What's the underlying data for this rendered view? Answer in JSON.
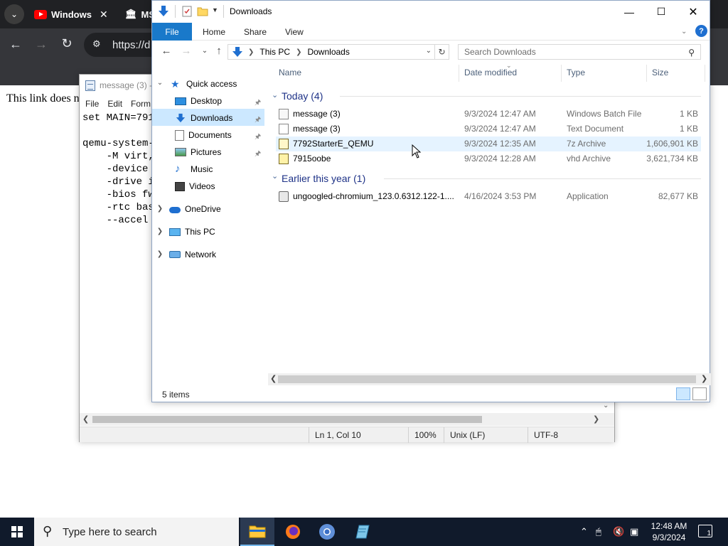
{
  "browser": {
    "tab1_title": "Windows",
    "tab2_title": "MS",
    "address_text": "https://d",
    "page_text": "This link does n"
  },
  "notepad": {
    "title": "message (3) -",
    "menu": [
      "File",
      "Edit",
      "Form"
    ],
    "lines": [
      "set MAIN=791",
      "",
      "qemu-system-",
      "    -M virt,",
      "    -device ",
      "    -drive i",
      "    -bios fw",
      "    -rtc bas",
      "    --accel "
    ],
    "status": {
      "position": "Ln 1, Col 10",
      "zoom": "100%",
      "line_ending": "Unix (LF)",
      "encoding": "UTF-8"
    }
  },
  "explorer": {
    "title": "Downloads",
    "ribbon_tabs": {
      "file": "File",
      "home": "Home",
      "share": "Share",
      "view": "View"
    },
    "help": "?",
    "breadcrumb": [
      "This PC",
      "Downloads"
    ],
    "search_placeholder": "Search Downloads",
    "nav": {
      "quick_access": "Quick access",
      "desktop": "Desktop",
      "downloads": "Downloads",
      "documents": "Documents",
      "pictures": "Pictures",
      "music": "Music",
      "videos": "Videos",
      "onedrive": "OneDrive",
      "this_pc": "This PC",
      "network": "Network"
    },
    "columns": {
      "name": "Name",
      "date": "Date modified",
      "type": "Type",
      "size": "Size"
    },
    "groups": {
      "today": "Today (4)",
      "earlier": "Earlier this year (1)"
    },
    "files": [
      {
        "name": "message (3)",
        "date": "9/3/2024 12:47 AM",
        "type": "Windows Batch File",
        "size": "1 KB"
      },
      {
        "name": "message (3)",
        "date": "9/3/2024 12:47 AM",
        "type": "Text Document",
        "size": "1 KB"
      },
      {
        "name": "7792StarterE_QEMU",
        "date": "9/3/2024 12:35 AM",
        "type": "7z Archive",
        "size": "1,606,901 KB"
      },
      {
        "name": "7915oobe",
        "date": "9/3/2024 12:28 AM",
        "type": "vhd Archive",
        "size": "3,621,734 KB"
      },
      {
        "name": "ungoogled-chromium_123.0.6312.122-1....",
        "date": "4/16/2024 3:53 PM",
        "type": "Application",
        "size": "82,677 KB"
      }
    ],
    "status_count": "5 items"
  },
  "taskbar": {
    "search_placeholder": "Type here to search",
    "time": "12:48 AM",
    "date": "9/3/2024",
    "notifications": "1"
  },
  "colors": {
    "accent": "#1979ca",
    "selection": "#cce8ff",
    "taskbar": "#101a2b"
  }
}
